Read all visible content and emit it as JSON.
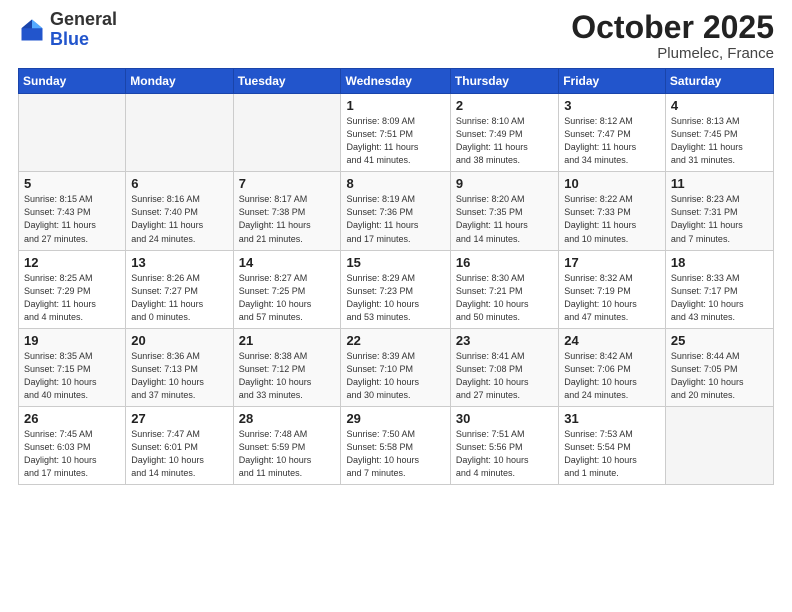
{
  "header": {
    "logo_general": "General",
    "logo_blue": "Blue",
    "month": "October 2025",
    "location": "Plumelec, France"
  },
  "weekdays": [
    "Sunday",
    "Monday",
    "Tuesday",
    "Wednesday",
    "Thursday",
    "Friday",
    "Saturday"
  ],
  "weeks": [
    [
      {
        "day": "",
        "info": ""
      },
      {
        "day": "",
        "info": ""
      },
      {
        "day": "",
        "info": ""
      },
      {
        "day": "1",
        "info": "Sunrise: 8:09 AM\nSunset: 7:51 PM\nDaylight: 11 hours\nand 41 minutes."
      },
      {
        "day": "2",
        "info": "Sunrise: 8:10 AM\nSunset: 7:49 PM\nDaylight: 11 hours\nand 38 minutes."
      },
      {
        "day": "3",
        "info": "Sunrise: 8:12 AM\nSunset: 7:47 PM\nDaylight: 11 hours\nand 34 minutes."
      },
      {
        "day": "4",
        "info": "Sunrise: 8:13 AM\nSunset: 7:45 PM\nDaylight: 11 hours\nand 31 minutes."
      }
    ],
    [
      {
        "day": "5",
        "info": "Sunrise: 8:15 AM\nSunset: 7:43 PM\nDaylight: 11 hours\nand 27 minutes."
      },
      {
        "day": "6",
        "info": "Sunrise: 8:16 AM\nSunset: 7:40 PM\nDaylight: 11 hours\nand 24 minutes."
      },
      {
        "day": "7",
        "info": "Sunrise: 8:17 AM\nSunset: 7:38 PM\nDaylight: 11 hours\nand 21 minutes."
      },
      {
        "day": "8",
        "info": "Sunrise: 8:19 AM\nSunset: 7:36 PM\nDaylight: 11 hours\nand 17 minutes."
      },
      {
        "day": "9",
        "info": "Sunrise: 8:20 AM\nSunset: 7:35 PM\nDaylight: 11 hours\nand 14 minutes."
      },
      {
        "day": "10",
        "info": "Sunrise: 8:22 AM\nSunset: 7:33 PM\nDaylight: 11 hours\nand 10 minutes."
      },
      {
        "day": "11",
        "info": "Sunrise: 8:23 AM\nSunset: 7:31 PM\nDaylight: 11 hours\nand 7 minutes."
      }
    ],
    [
      {
        "day": "12",
        "info": "Sunrise: 8:25 AM\nSunset: 7:29 PM\nDaylight: 11 hours\nand 4 minutes."
      },
      {
        "day": "13",
        "info": "Sunrise: 8:26 AM\nSunset: 7:27 PM\nDaylight: 11 hours\nand 0 minutes."
      },
      {
        "day": "14",
        "info": "Sunrise: 8:27 AM\nSunset: 7:25 PM\nDaylight: 10 hours\nand 57 minutes."
      },
      {
        "day": "15",
        "info": "Sunrise: 8:29 AM\nSunset: 7:23 PM\nDaylight: 10 hours\nand 53 minutes."
      },
      {
        "day": "16",
        "info": "Sunrise: 8:30 AM\nSunset: 7:21 PM\nDaylight: 10 hours\nand 50 minutes."
      },
      {
        "day": "17",
        "info": "Sunrise: 8:32 AM\nSunset: 7:19 PM\nDaylight: 10 hours\nand 47 minutes."
      },
      {
        "day": "18",
        "info": "Sunrise: 8:33 AM\nSunset: 7:17 PM\nDaylight: 10 hours\nand 43 minutes."
      }
    ],
    [
      {
        "day": "19",
        "info": "Sunrise: 8:35 AM\nSunset: 7:15 PM\nDaylight: 10 hours\nand 40 minutes."
      },
      {
        "day": "20",
        "info": "Sunrise: 8:36 AM\nSunset: 7:13 PM\nDaylight: 10 hours\nand 37 minutes."
      },
      {
        "day": "21",
        "info": "Sunrise: 8:38 AM\nSunset: 7:12 PM\nDaylight: 10 hours\nand 33 minutes."
      },
      {
        "day": "22",
        "info": "Sunrise: 8:39 AM\nSunset: 7:10 PM\nDaylight: 10 hours\nand 30 minutes."
      },
      {
        "day": "23",
        "info": "Sunrise: 8:41 AM\nSunset: 7:08 PM\nDaylight: 10 hours\nand 27 minutes."
      },
      {
        "day": "24",
        "info": "Sunrise: 8:42 AM\nSunset: 7:06 PM\nDaylight: 10 hours\nand 24 minutes."
      },
      {
        "day": "25",
        "info": "Sunrise: 8:44 AM\nSunset: 7:05 PM\nDaylight: 10 hours\nand 20 minutes."
      }
    ],
    [
      {
        "day": "26",
        "info": "Sunrise: 7:45 AM\nSunset: 6:03 PM\nDaylight: 10 hours\nand 17 minutes."
      },
      {
        "day": "27",
        "info": "Sunrise: 7:47 AM\nSunset: 6:01 PM\nDaylight: 10 hours\nand 14 minutes."
      },
      {
        "day": "28",
        "info": "Sunrise: 7:48 AM\nSunset: 5:59 PM\nDaylight: 10 hours\nand 11 minutes."
      },
      {
        "day": "29",
        "info": "Sunrise: 7:50 AM\nSunset: 5:58 PM\nDaylight: 10 hours\nand 7 minutes."
      },
      {
        "day": "30",
        "info": "Sunrise: 7:51 AM\nSunset: 5:56 PM\nDaylight: 10 hours\nand 4 minutes."
      },
      {
        "day": "31",
        "info": "Sunrise: 7:53 AM\nSunset: 5:54 PM\nDaylight: 10 hours\nand 1 minute."
      },
      {
        "day": "",
        "info": ""
      }
    ]
  ]
}
